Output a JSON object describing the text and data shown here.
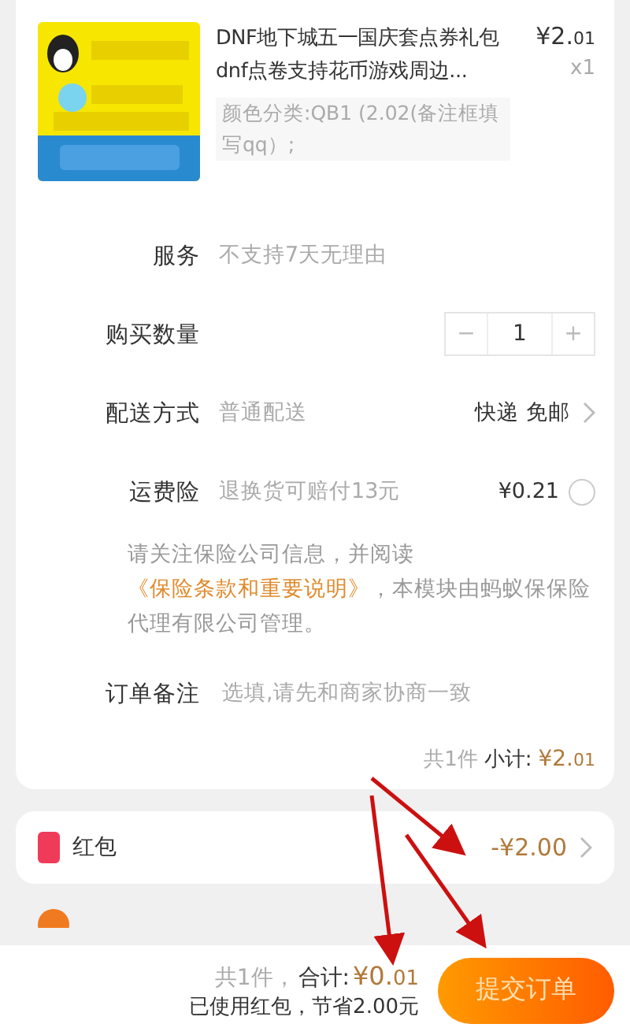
{
  "product": {
    "title": "DNF地下城五一国庆套点券礼包dnf点卷支持花币游戏周边...",
    "sku": "颜色分类:QB1 (2.02(备注框填写qq）;",
    "price_main": "¥2.",
    "price_cents": "01",
    "count": "x1"
  },
  "rows": [
    {
      "kind": "text",
      "label": "服务",
      "value": "不支持7天无理由"
    },
    {
      "kind": "stepper",
      "label": "购买数量",
      "minus": "−",
      "qty": "1",
      "plus": "+"
    },
    {
      "kind": "option",
      "label": "配送方式",
      "value": "普通配送",
      "right": "快递 免邮"
    },
    {
      "kind": "radio",
      "label": "运费险",
      "value": "退换货可赔付13元",
      "right": "¥0.21",
      "checked": false
    },
    {
      "kind": "notice",
      "before": "请关注保险公司信息，并阅读",
      "link": "《保险条款和重要说明》",
      "after": "，本模块由蚂蚁保保险代理有限公司管理。"
    },
    {
      "kind": "input",
      "label": "订单备注",
      "placeholder": "选填,请先和商家协商一致"
    }
  ],
  "subtotal": {
    "count": "共1件",
    "label": "小计:",
    "price_main": "¥2.",
    "price_cents": "01"
  },
  "red_packet": {
    "label": "红包",
    "amount": "-¥2.00"
  },
  "footer": {
    "count": "共1件，",
    "label": "合计:",
    "price_main": "¥0.",
    "price_cents": "01",
    "saved": "已使用红包，节省2.00元",
    "submit": "提交订单"
  }
}
